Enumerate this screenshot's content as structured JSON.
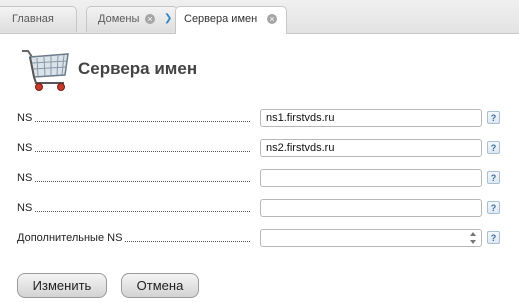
{
  "tabs": [
    {
      "label": "Главная",
      "closable": false
    },
    {
      "label": "Домены",
      "closable": true
    },
    {
      "label": "Сервера имен",
      "closable": true,
      "active": true
    }
  ],
  "header": {
    "title": "Сервера имен",
    "icon": "shopping-cart-icon"
  },
  "form": {
    "rows": [
      {
        "label": "NS",
        "value": "ns1.firstvds.ru"
      },
      {
        "label": "NS",
        "value": "ns2.firstvds.ru"
      },
      {
        "label": "NS",
        "value": ""
      },
      {
        "label": "NS",
        "value": ""
      },
      {
        "label": "Дополнительные NS",
        "value": ""
      }
    ],
    "help_glyph": "?"
  },
  "buttons": {
    "submit": "Изменить",
    "cancel": "Отмена"
  },
  "colors": {
    "accent": "#2f86c8",
    "title": "#444444"
  }
}
